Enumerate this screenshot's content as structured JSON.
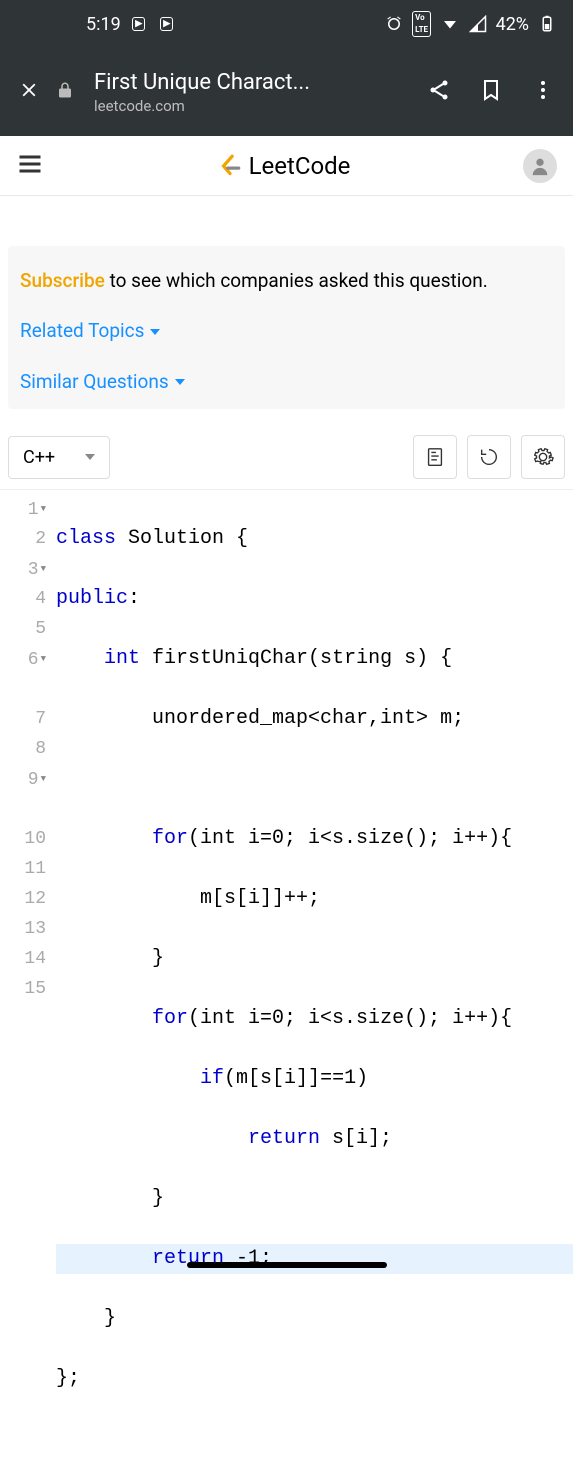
{
  "status": {
    "time": "5:19",
    "battery": "42%"
  },
  "browser": {
    "title": "First Unique Charact...",
    "domain": "leetcode.com"
  },
  "app": {
    "brand": "LeetCode"
  },
  "notice": {
    "subscribe": "Subscribe",
    "rest": " to see which companies asked this question.",
    "related": "Related Topics",
    "similar": "Similar Questions"
  },
  "editor": {
    "language": "C++",
    "lines": [
      {
        "n": "1",
        "fold": true
      },
      {
        "n": "2"
      },
      {
        "n": "3",
        "fold": true
      },
      {
        "n": "4"
      },
      {
        "n": "5"
      },
      {
        "n": "6",
        "fold": true
      },
      {
        "n": "7"
      },
      {
        "n": "8"
      },
      {
        "n": "9",
        "fold": true
      },
      {
        "n": "10"
      },
      {
        "n": "11"
      },
      {
        "n": "12"
      },
      {
        "n": "13"
      },
      {
        "n": "14"
      },
      {
        "n": "15"
      }
    ],
    "code": {
      "l1": {
        "kw": "class",
        "rest": " Solution {"
      },
      "l2": {
        "kw": "public",
        "rest": ":"
      },
      "l3": {
        "indent": "    ",
        "type": "int",
        "rest": " firstUniqChar(string s) {"
      },
      "l4": "        unordered_map<char,int> m;",
      "l5": "",
      "l6": {
        "indent": "        ",
        "kw": "for",
        "rest": "(int i=0; i<s.size(); i++){"
      },
      "l7": "            m[s[i]]++;",
      "l8": "        }",
      "l9": {
        "indent": "        ",
        "kw": "for",
        "rest": "(int i=0; i<s.size(); i++){"
      },
      "l10": {
        "indent": "            ",
        "kw": "if",
        "rest": "(m[s[i]]==1)"
      },
      "l11": {
        "indent": "                ",
        "kw": "return",
        "rest": " s[i];"
      },
      "l12": "        }",
      "l13": {
        "indent": "        ",
        "kw": "return",
        "rest": " -1;"
      },
      "l14": "    }",
      "l15": "};"
    }
  }
}
